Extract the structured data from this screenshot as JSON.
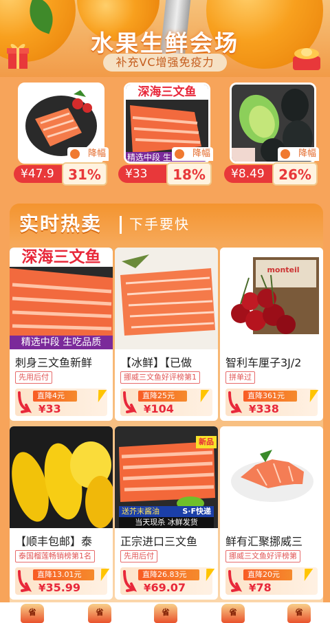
{
  "banner": {
    "title": "水果生鲜会场",
    "subtitle": "补充VC增强免疫力"
  },
  "deals": [
    {
      "price_symbol": "¥",
      "price": "47.9",
      "drop_label": "降幅",
      "percent": "31%",
      "image": "salmon-plate"
    },
    {
      "price_symbol": "¥",
      "price": "33",
      "drop_label": "降幅",
      "percent": "18%",
      "image": "salmon-slices",
      "overlay_title": "深海三文鱼",
      "overlay_caption": "精选中段 生"
    },
    {
      "price_symbol": "¥",
      "price": "8.49",
      "drop_label": "降幅",
      "percent": "26%",
      "image": "avocado"
    }
  ],
  "hot": {
    "title": "实时热卖",
    "subtitle": "下手要快",
    "items": [
      {
        "name": "刺身三文鱼新鲜",
        "tag": "先用后付",
        "cut": "直降4元",
        "symbol": "¥",
        "price": "33",
        "image": "salmon-slices",
        "overlay_title": "深海三文鱼",
        "overlay_caption": "精选中段 生吃品质"
      },
      {
        "name": "【冰鲜】【已做",
        "tag": "挪威三文鱼好评榜第1",
        "cut": "直降25元",
        "symbol": "¥",
        "price": "104",
        "image": "salmon-block"
      },
      {
        "name": "智利车厘子3J/2",
        "tag": "拼单过",
        "cut": "直降361元",
        "symbol": "¥",
        "price": "338",
        "image": "cherries",
        "box_label": "monteil"
      },
      {
        "name": "【顺丰包邮】泰",
        "tag": "泰国榴莲畅销榜第1名",
        "cut": "直降13.01元",
        "symbol": "¥",
        "price": "35.99",
        "image": "durian"
      },
      {
        "name": "正宗进口三文鱼",
        "tag": "先用后付",
        "cut": "直降26.83元",
        "symbol": "¥",
        "price": "69.07",
        "image": "salmon-sashimi",
        "badge_new": "新品",
        "strip1": "送芥末酱油",
        "strip1b": "S·F快递",
        "strip2": "当天现杀 冰鲜发货"
      },
      {
        "name": "鲜有汇聚挪威三",
        "tag": "挪威三文鱼好评榜第",
        "cut": "直降20元",
        "symbol": "¥",
        "price": "78",
        "image": "salmon-dish"
      }
    ]
  },
  "bottom_icons": [
    "省",
    "省",
    "省",
    "省",
    "省"
  ],
  "colors": {
    "accent": "#e8383a",
    "orange": "#f4942f",
    "cut_bg": "#f85c26"
  }
}
